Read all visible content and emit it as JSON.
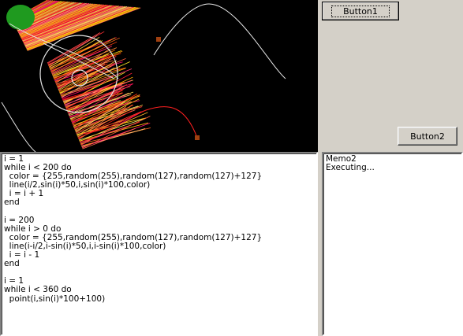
{
  "buttons": {
    "button1_label": "Button1",
    "button2_label": "Button2"
  },
  "code_memo": {
    "lines": [
      "i = 1",
      "while i < 200 do",
      "  color = {255,random(255),random(127),random(127)+127}",
      "  line(i/2,sin(i)*50,i,sin(i)*100,color)",
      "  i = i + 1",
      "end",
      "",
      "i = 200",
      "while i > 0 do",
      "  color = {255,random(255),random(127),random(127)+127}",
      "  line(i-i/2,i-sin(i)*50,i,i-sin(i)*100,color)",
      "  i = i - 1",
      "end",
      "",
      "i = 1",
      "while i < 360 do",
      "  point(i,sin(i)*100+100)"
    ]
  },
  "log_memo": {
    "lines": [
      "Memo2",
      "Executing..."
    ]
  },
  "colors": {
    "canvas_bg": "#000000",
    "form_bg": "#d4d0c8",
    "sine_curve": "#ffffff",
    "red_curve": "#ff2020",
    "ellipse_fill": "#1f9a1f",
    "square_marker": "#a04010"
  }
}
